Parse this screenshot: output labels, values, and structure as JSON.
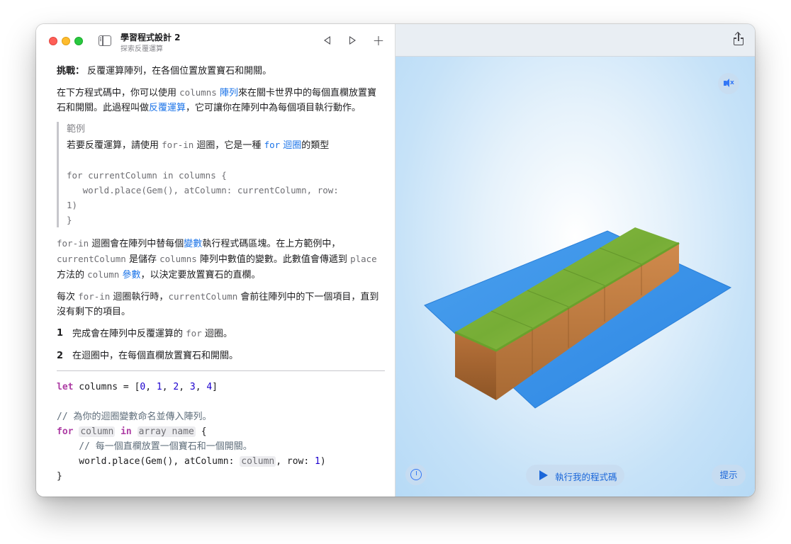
{
  "window": {
    "title": "學習程式設計 2",
    "subtitle": "探索反覆運算"
  },
  "icons": {
    "sidebar": "sidebar-icon",
    "back": "back-icon",
    "forward": "forward-icon",
    "add": "plus-icon",
    "share": "share-icon",
    "sound": "speaker-muted-icon",
    "speed": "speedometer-icon",
    "run": "play-icon"
  },
  "toolbar": {
    "add_label": "+"
  },
  "lesson": {
    "challenge_label": "挑戰：",
    "challenge_text": " 反覆運算陣列，在各個位置放置寶石和開關。",
    "p1": {
      "a": "在下方程式碼中，你可以使用 ",
      "b": "columns",
      "c": " ",
      "d": "陣列",
      "e": "來在關卡世界中的每個直欄放置寶石和開關。此過程叫做",
      "f": "反覆運算",
      "g": "，它可讓你在陣列中為每個項目執行動作。"
    },
    "example": {
      "title": "範例",
      "a": "若要反覆運算，請使用 ",
      "b": "for-in",
      "c": " 迴圈，它是一種 ",
      "d": "for",
      "e": " 迴圈",
      "f": "的類型",
      "code": "for currentColumn in columns {\n   world.place(Gem(), atColumn: currentColumn, row:\n1)\n}"
    },
    "p2": {
      "a": "for-in",
      "b": " 迴圈會在陣列中替每個",
      "c": "變數",
      "d": "執行程式碼區塊。在上方範例中，",
      "e": "currentColumn",
      "f": " 是儲存 ",
      "g": "columns",
      "h": " 陣列中數值的變數。此數值會傳遞到 ",
      "i": "place",
      "j": " 方法的 ",
      "k": "column",
      "l": " ",
      "m": "參數",
      "n": "，以決定要放置寶石的直欄。"
    },
    "p3": {
      "a": "每次 ",
      "b": "for-in",
      "c": " 迴圈執行時，",
      "d": "currentColumn",
      "e": " 會前往陣列中的下一個項目，直到沒有剩下的項目。"
    },
    "steps": [
      {
        "num": "1",
        "a": "完成會在陣列中反覆運算的 ",
        "b": "for",
        "c": " 迴圈。"
      },
      {
        "num": "2",
        "a": "在迴圈中，在每個直欄放置寶石和開關。"
      }
    ]
  },
  "code": {
    "l1_kw": "let",
    "l1_a": " columns = [",
    "l1_n0": "0",
    "l1_n1": "1",
    "l1_n2": "2",
    "l1_n3": "3",
    "l1_n4": "4",
    "l1_sep": ", ",
    "l1_end": "]",
    "l3_comment": "// 為你的迴圈變數命名並傳入陣列。",
    "l4_kw1": "for",
    "l4_ph1": "column",
    "l4_kw2": "in",
    "l4_ph2": "array name",
    "l4_end": " {",
    "l5_comment": "    // 每一個直欄放置一個寶石和一個開關。",
    "l6_a": "    world.place(Gem(), atColumn: ",
    "l6_ph": "column",
    "l6_b": ", row: ",
    "l6_n": "1",
    "l6_c": ")",
    "l7": "}"
  },
  "live_view": {
    "run_label": "執行我的程式碼",
    "hint_label": "提示"
  },
  "colors": {
    "accent": "#1a73e8",
    "water": "#3a8fe6",
    "grass": "#7fb43a",
    "dirt": "#a0612a"
  }
}
